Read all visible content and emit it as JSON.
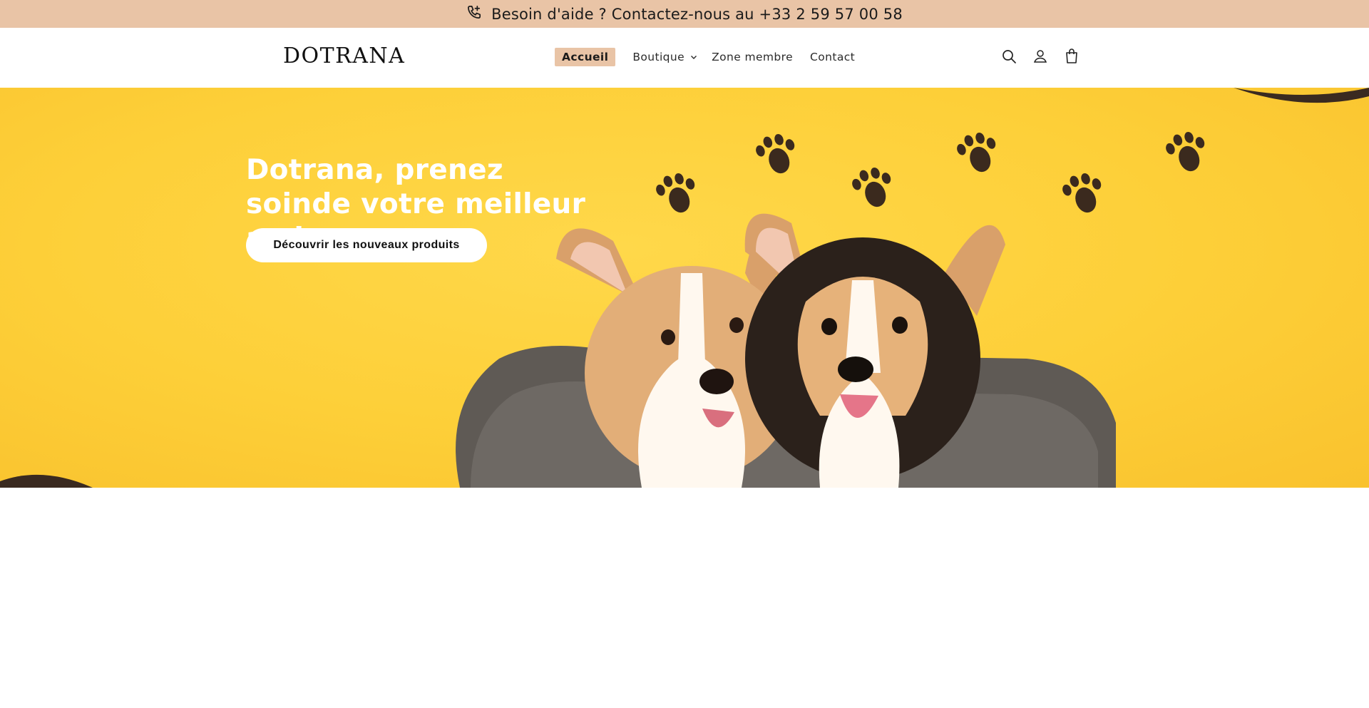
{
  "announcement": {
    "text": "Besoin d'aide ? Contactez-nous au +33 2 59 57 00 58",
    "icon": "phone-plus-icon"
  },
  "header": {
    "logo": "DOTRANA",
    "nav": [
      {
        "label": "Accueil",
        "active": true
      },
      {
        "label": "Boutique",
        "has_dropdown": true
      },
      {
        "label": "Zone membre"
      },
      {
        "label": "Contact"
      }
    ],
    "icons": [
      "search-icon",
      "account-icon",
      "cart-icon"
    ]
  },
  "hero": {
    "title": "Dotrana, prenez soinde votre meilleur ami",
    "button_label": "Découvrir les nouveaux produits",
    "background_color": "#fdcf38",
    "image_description_icons": [
      "paw-icon",
      "dog-icon",
      "dog-bed-icon"
    ]
  },
  "colors": {
    "accent": "#e9c4a6",
    "hero_yellow": "#fdcf38",
    "text": "#121212"
  }
}
